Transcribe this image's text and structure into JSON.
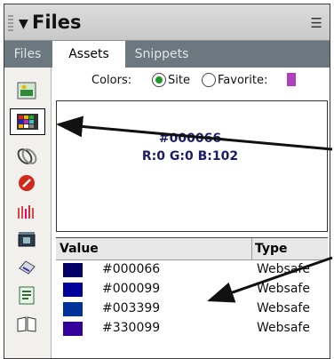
{
  "panel": {
    "title": "Files"
  },
  "tabs": [
    {
      "label": "Files"
    },
    {
      "label": "Assets"
    },
    {
      "label": "Snippets"
    }
  ],
  "colors_row": {
    "label": "Colors:",
    "site_label": "Site",
    "favorites_label": "Favorite:",
    "selected": "Site"
  },
  "preview": {
    "hex": "#000066",
    "rgb": "R:0 G:0 B:102"
  },
  "table": {
    "headers": {
      "value": "Value",
      "type": "Type"
    },
    "rows": [
      {
        "swatch": "#000066",
        "hex": "#000066",
        "type": "Websafe"
      },
      {
        "swatch": "#000099",
        "hex": "#000099",
        "type": "Websafe"
      },
      {
        "swatch": "#003399",
        "hex": "#003399",
        "type": "Websafe"
      },
      {
        "swatch": "#330099",
        "hex": "#330099",
        "type": "Websafe"
      }
    ]
  },
  "strip_icons": [
    "images-icon",
    "colors-icon",
    "urls-icon",
    "flash-icon",
    "shockwave-icon",
    "movies-icon",
    "scripts-icon",
    "templates-icon",
    "library-icon"
  ],
  "accent": {
    "tab_bar": "#6b7880",
    "preview_text": "#1c1c6a",
    "radio_on": "#1b9a2a"
  }
}
